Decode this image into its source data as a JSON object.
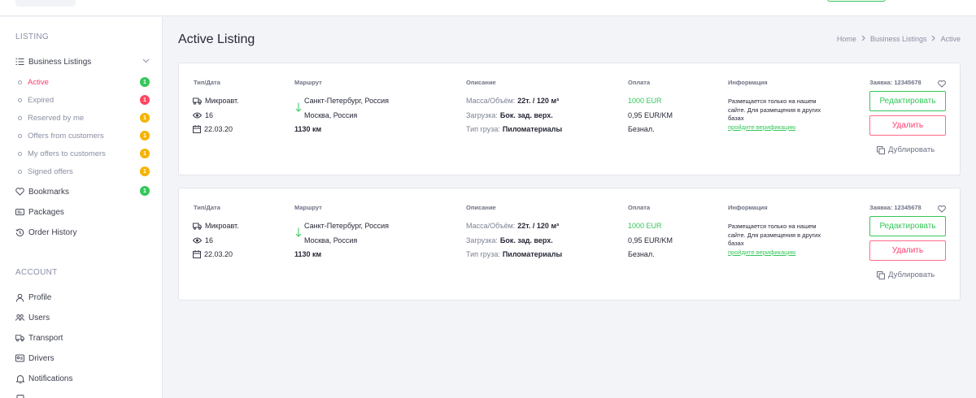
{
  "sidebar": {
    "listing_title": "LISTING",
    "business_listings": "Business Listings",
    "subitems": [
      {
        "label": "Active",
        "badge": "1",
        "badge_color": "#34c759"
      },
      {
        "label": "Expired",
        "badge": "1",
        "badge_color": "#ff4560"
      },
      {
        "label": "Reserved by me",
        "badge": "1",
        "badge_color": "#f5b301"
      },
      {
        "label": "Offers from customers",
        "badge": "1",
        "badge_color": "#f5b301"
      },
      {
        "label": "My offers to customers",
        "badge": "1",
        "badge_color": "#f5b301"
      },
      {
        "label": "Signed offers",
        "badge": "1",
        "badge_color": "#f5b301"
      }
    ],
    "bookmarks": "Bookmarks",
    "bookmarks_badge": "1",
    "packages": "Packages",
    "order_history": "Order History",
    "account_title": "ACCOUNT",
    "account_items": [
      "Profile",
      "Users",
      "Transport",
      "Drivers",
      "Notifications"
    ]
  },
  "header": {
    "title": "Active Listing",
    "breadcrumb": [
      "Home",
      "Business Listings",
      "Active"
    ]
  },
  "columns": {
    "type_date": "Тип/Дата",
    "route": "Маршрут",
    "description": "Описание",
    "payment": "Оплата",
    "info": "Информация"
  },
  "listings": [
    {
      "order_no": "Заявка: 12345678",
      "vehicle": "Микроавт.",
      "views": "16",
      "date": "22.03.20",
      "from": "Санкт-Петербург, Россия",
      "to": "Москва, Россия",
      "distance": "1130 км",
      "mass_label": "Масса/Объём:",
      "mass_value": "22т. / 120 м³",
      "load_label": "Загрузка:",
      "load_value": "Бок. зад. верх.",
      "cargo_label": "Тип груза:",
      "cargo_value": "Пиломатериалы",
      "price": "1000 EUR",
      "rate": "0,95 EUR/KM",
      "pay_type": "Безнал.",
      "info_text": "Размещается только на нашем сайте. Для размещения в других базах",
      "info_link": "пройдите верификацию",
      "edit": "Редактировать",
      "delete": "Удалить",
      "duplicate": "Дублировать"
    },
    {
      "order_no": "Заявка: 12345678",
      "vehicle": "Микроавт.",
      "views": "16",
      "date": "22.03.20",
      "from": "Санкт-Петербург, Россия",
      "to": "Москва, Россия",
      "distance": "1130 км",
      "mass_label": "Масса/Объём:",
      "mass_value": "22т. / 120 м³",
      "load_label": "Загрузка:",
      "load_value": "Бок. зад. верх.",
      "cargo_label": "Тип груза:",
      "cargo_value": "Пиломатериалы",
      "price": "1000 EUR",
      "rate": "0,95 EUR/KM",
      "pay_type": "Безнал.",
      "info_text": "Размещается только на нашем сайте. Для размещения в других базах",
      "info_link": "пройдите верификацию",
      "edit": "Редактировать",
      "delete": "Удалить",
      "duplicate": "Дублировать"
    }
  ],
  "colors": {
    "accent_green": "#34c759",
    "accent_red": "#ff3b6b",
    "badge_yellow": "#f5b301"
  }
}
